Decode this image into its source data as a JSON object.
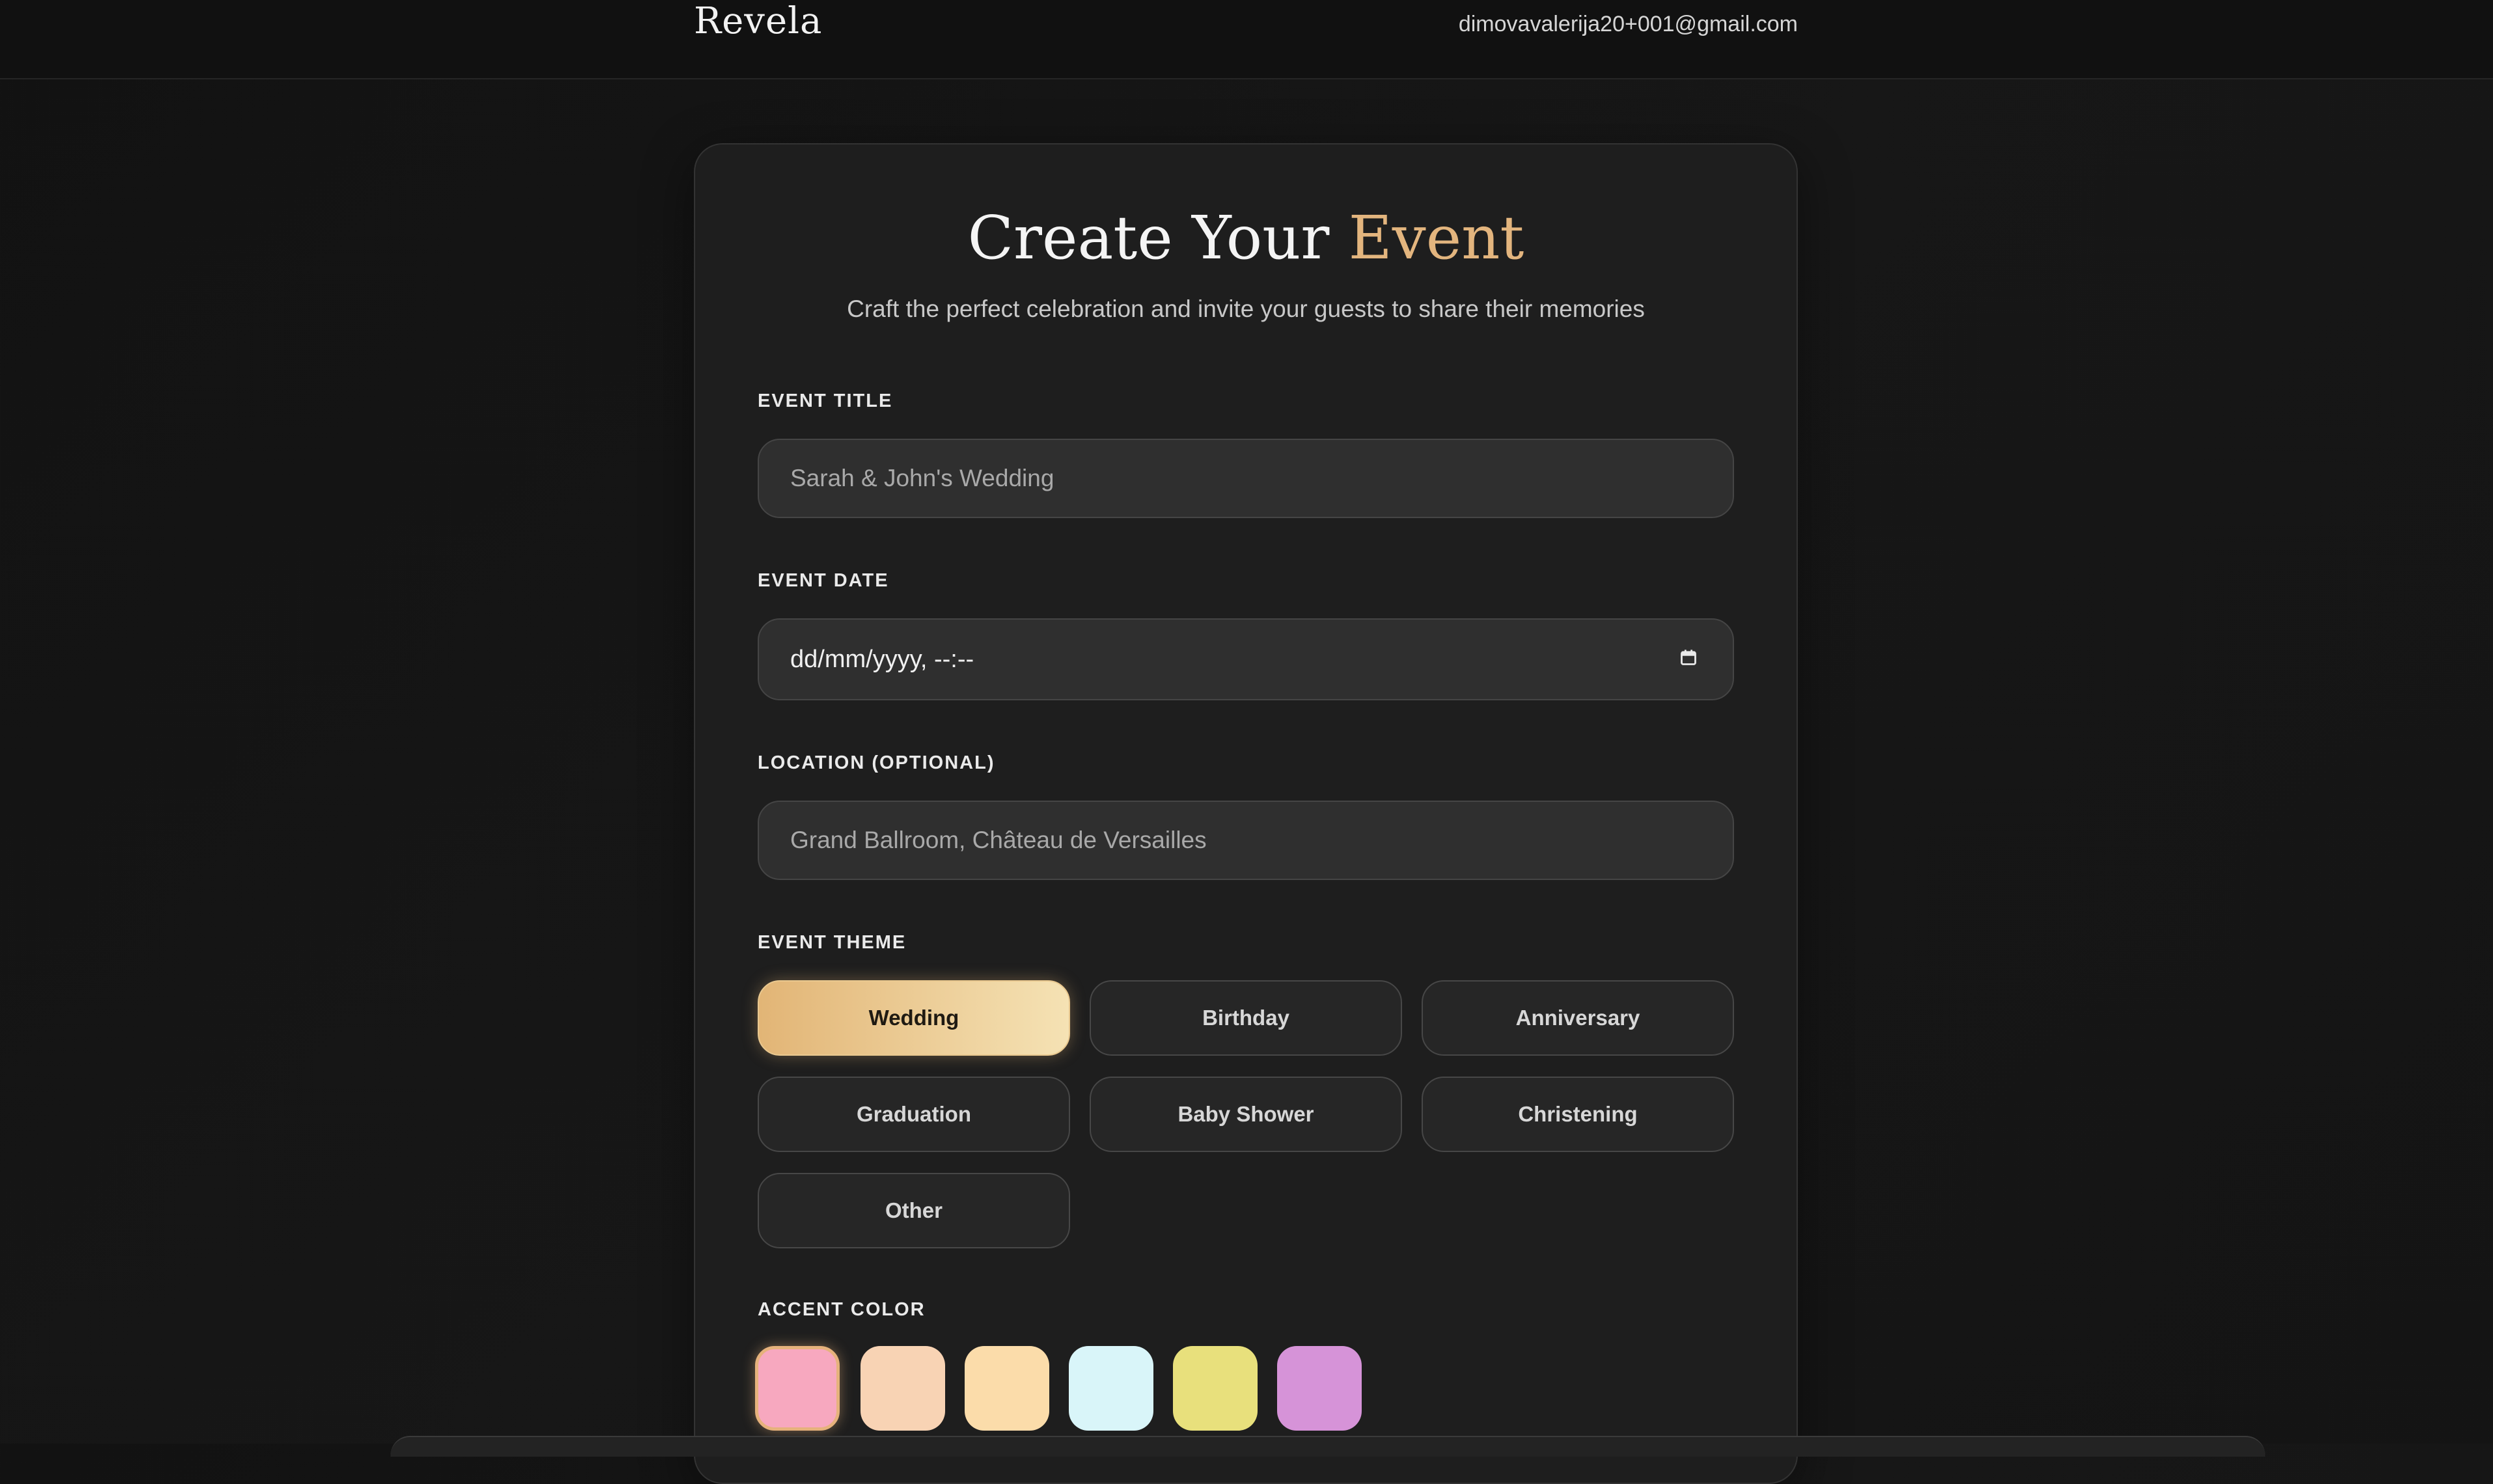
{
  "header": {
    "logo": "Revela",
    "user_email": "dimovavalerija20+001@gmail.com"
  },
  "card": {
    "title_main": "Create Your",
    "title_accent": "Event",
    "subtitle": "Craft the perfect celebration and invite your guests to share their memories"
  },
  "form": {
    "event_title": {
      "label": "EVENT TITLE",
      "placeholder": "Sarah & John's Wedding",
      "value": ""
    },
    "event_date": {
      "label": "EVENT DATE",
      "display": "dd/mm/yyyy, --:--",
      "icon": "calendar-icon"
    },
    "location": {
      "label": "LOCATION (OPTIONAL)",
      "placeholder": "Grand Ballroom, Château de Versailles",
      "value": ""
    },
    "theme": {
      "label": "EVENT THEME",
      "selected": "Wedding",
      "options": [
        "Wedding",
        "Birthday",
        "Anniversary",
        "Graduation",
        "Baby Shower",
        "Christening",
        "Other"
      ]
    },
    "accent_color": {
      "label": "ACCENT COLOR",
      "selected_index": 0,
      "swatches": [
        "#f7a8bf",
        "#f8d3b4",
        "#fbdcaa",
        "#d9f5f9",
        "#e8e07c",
        "#d693d8"
      ]
    }
  },
  "colors": {
    "accent": "#e3b57e",
    "background": "#141414",
    "card": "#1e1e1e"
  }
}
